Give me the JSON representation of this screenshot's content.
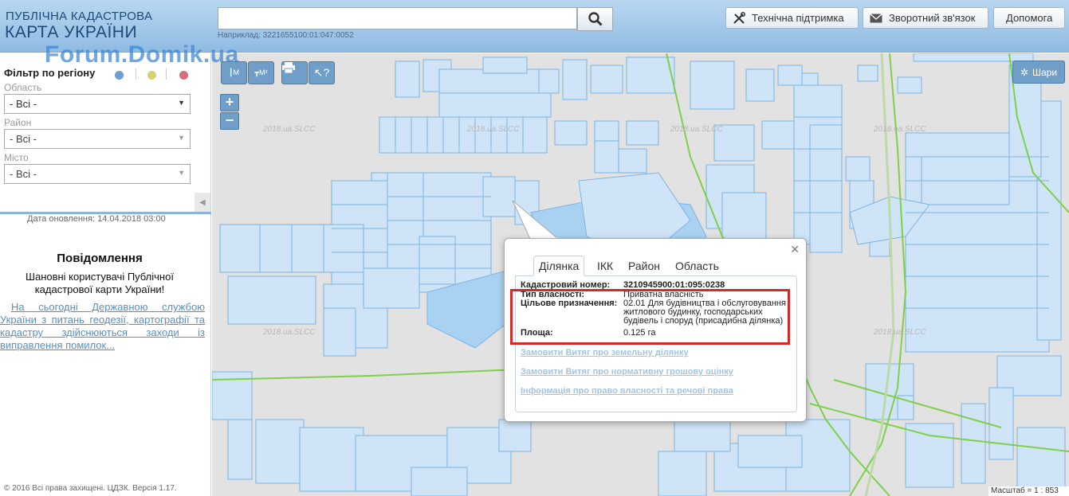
{
  "header": {
    "logo_line1": "ПУБЛІЧНА КАДАСТРОВА",
    "logo_line2": "КАРТА УКРАЇНИ",
    "search_placeholder": "",
    "search_hint": "Наприклад: 3221655100:01:047:0052",
    "buttons": [
      "Технічна підтримка",
      "Зворотний зв'язок",
      "Допомога"
    ]
  },
  "watermark": "Forum.Domik.ua",
  "sidebar": {
    "filter_title": "Фільтр по регіону",
    "filter_colors": [
      "#6d9fd2",
      "#d6d36a",
      "#d56e7c"
    ],
    "fields": [
      {
        "label": "Область",
        "value": "- Всі -"
      },
      {
        "label": "Район",
        "value": "- Всі -"
      },
      {
        "label": "Місто",
        "value": "- Всі -"
      }
    ],
    "update_date": "Дата оновлення: 14.04.2018 03:00",
    "notice_title": "Повідомлення",
    "notice_text": "Шановні користувачі Публічної кадастрової карти України!",
    "notice_link": "На сьогодні Державною службою України з питань геодезії, картографії та кадастру здійснюються заходи із виправлення помилок...",
    "copyright": "© 2016 Всі права захищені. ЦДЗК. Версія 1.17."
  },
  "map": {
    "tools": [
      "М",
      "М²"
    ],
    "zoom_in": "+",
    "zoom_out": "−",
    "layers_label": "Шари",
    "scale": "Масштаб = 1 : 853",
    "watermark_text": "2018.ua.SLCC"
  },
  "popup": {
    "tabs": [
      "Ділянка",
      "ІКК",
      "Район",
      "Область"
    ],
    "active_tab": "Ділянка",
    "rows": [
      {
        "key": "Кадастровий номер:",
        "value": "3210945900:01:095:0238"
      },
      {
        "key": "Тип власності:",
        "value": "Приватна власність"
      },
      {
        "key": "Цільове призначення:",
        "value": "02.01 Для будівництва і обслуговування житлового будинку, господарських будівель і споруд (присадибна ділянка)"
      },
      {
        "key": "Площа:",
        "value": "0.125 га"
      }
    ],
    "links": [
      "Замовити Витяг про земельну ділянку",
      "Замовити Витяг про нормативну грошову оцінку",
      "Інформація про право власності та речові права"
    ]
  },
  "colors": {
    "highlight": "#d02a2a",
    "parcel_fill": "#cfe4f7",
    "parcel_stroke": "#7eb3e3",
    "boundary": "#7ed04a"
  }
}
